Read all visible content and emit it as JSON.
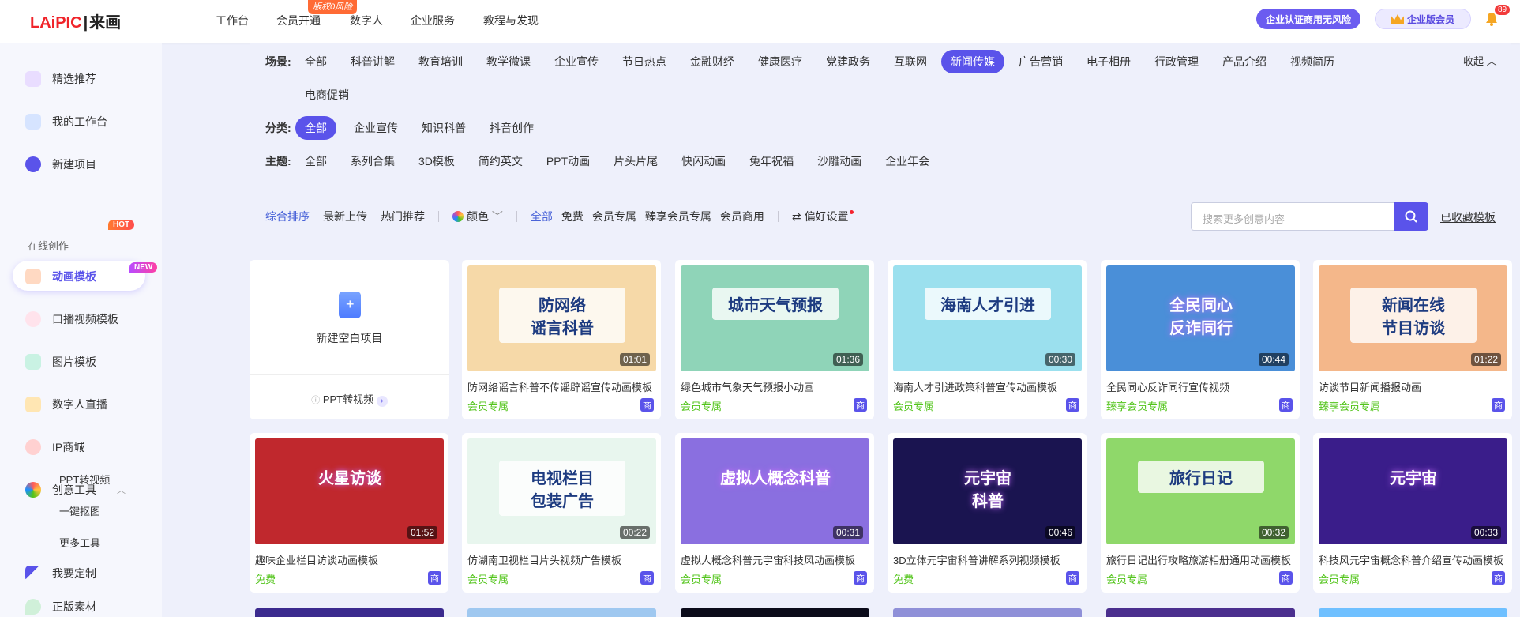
{
  "nav": {
    "logo_a": "LAiPIC",
    "logo_b": "来画",
    "items": [
      "工作台",
      "会员开通",
      "数字人",
      "企业服务",
      "教程与发现"
    ],
    "free_tag": "版权0风险",
    "cert_button": "企业认证商用无风险",
    "vip_button": "企业版会员",
    "bell_count": "89"
  },
  "sidebar": {
    "items": [
      "精选推荐",
      "我的工作台",
      "新建项目"
    ],
    "section_label": "在线创作",
    "active_item": "动画模板",
    "hot_badge": "HOT",
    "oral_item": "口播视频模板",
    "new_badge": "NEW",
    "more_items": [
      "图片模板",
      "数字人直播",
      "IP商城",
      "创意工具"
    ],
    "sub_items": [
      "PPT转视频",
      "一键抠图",
      "更多工具"
    ],
    "bottom_items": [
      "我要定制",
      "正版素材"
    ]
  },
  "filters": {
    "scene_label": "场景:",
    "scenes": [
      "全部",
      "科普讲解",
      "教育培训",
      "教学微课",
      "企业宣传",
      "节日热点",
      "金融财经",
      "健康医疗",
      "党建政务",
      "互联网",
      "新闻传媒",
      "广告营销",
      "电子相册",
      "行政管理",
      "产品介绍",
      "视频简历"
    ],
    "scenes_row2": [
      "电商促销"
    ],
    "scene_active": "新闻传媒",
    "category_label": "分类:",
    "categories": [
      "全部",
      "企业宣传",
      "知识科普",
      "抖音创作"
    ],
    "theme_label": "主题:",
    "themes": [
      "全部",
      "系列合集",
      "3D模板",
      "简约英文",
      "PPT动画",
      "片头片尾",
      "快闪动画",
      "兔年祝福",
      "沙雕动画",
      "企业年会"
    ],
    "collapse": "收起"
  },
  "sortbar": {
    "sorts": [
      "综合排序",
      "最新上传",
      "热门推荐"
    ],
    "color": "颜色",
    "tiers": [
      "全部",
      "免费",
      "会员专属",
      "臻享会员专属",
      "会员商用"
    ],
    "prefs": "偏好设置",
    "search_placeholder": "搜索更多创意内容",
    "fav_link": "已收藏模板"
  },
  "new_card": {
    "label": "新建空白项目",
    "ppt": "PPT转视频"
  },
  "cards": [
    {
      "title": "防网络谣言科普不传谣辟谣宣传动画模板",
      "tag": "会员专属",
      "duration": "01:01",
      "thumb_text": "防网络\n谣言科普",
      "bg": "#f6d9a8"
    },
    {
      "title": "绿色城市气象天气预报小动画",
      "tag": "会员专属",
      "duration": "01:36",
      "thumb_text": "城市天气预报",
      "bg": "#8fd4b8"
    },
    {
      "title": "海南人才引进政策科普宣传动画模板",
      "tag": "会员专属",
      "duration": "00:30",
      "thumb_text": "海南人才引进",
      "bg": "#9be0ee"
    },
    {
      "title": "全民同心反诈同行宣传视频",
      "tag": "臻享会员专属",
      "duration": "00:44",
      "thumb_text": "全民同心\n反诈同行",
      "bg": "#4a8fd8"
    },
    {
      "title": "访谈节目新闻播报动画",
      "tag": "臻享会员专属",
      "duration": "01:22",
      "thumb_text": "新闻在线\n节目访谈",
      "bg": "#f4b78a"
    },
    {
      "title": "趣味企业栏目访谈动画模板",
      "tag": "免费",
      "duration": "01:52",
      "thumb_text": "火星访谈",
      "bg": "#c0282d"
    },
    {
      "title": "仿湖南卫视栏目片头视频广告模板",
      "tag": "会员专属",
      "duration": "00:22",
      "thumb_text": "电视栏目\n包装广告",
      "bg": "#e8f6ee"
    },
    {
      "title": "虚拟人概念科普元宇宙科技风动画模板",
      "tag": "会员专属",
      "duration": "00:31",
      "thumb_text": "虚拟人概念科普",
      "bg": "#8a6fe0"
    },
    {
      "title": "3D立体元宇宙科普讲解系列视频模板",
      "tag": "免费",
      "duration": "00:46",
      "thumb_text": "元宇宙\n科普",
      "bg": "#1a1450"
    },
    {
      "title": "旅行日记出行攻略旅游相册通用动画模板",
      "tag": "会员专属",
      "duration": "00:32",
      "thumb_text": "旅行日记",
      "bg": "#8fd86a"
    },
    {
      "title": "科技风元宇宙概念科普介绍宣传动画模板",
      "tag": "会员专属",
      "duration": "00:33",
      "thumb_text": "元宇宙",
      "bg": "#3a1d8a"
    }
  ],
  "shang_label": "商"
}
